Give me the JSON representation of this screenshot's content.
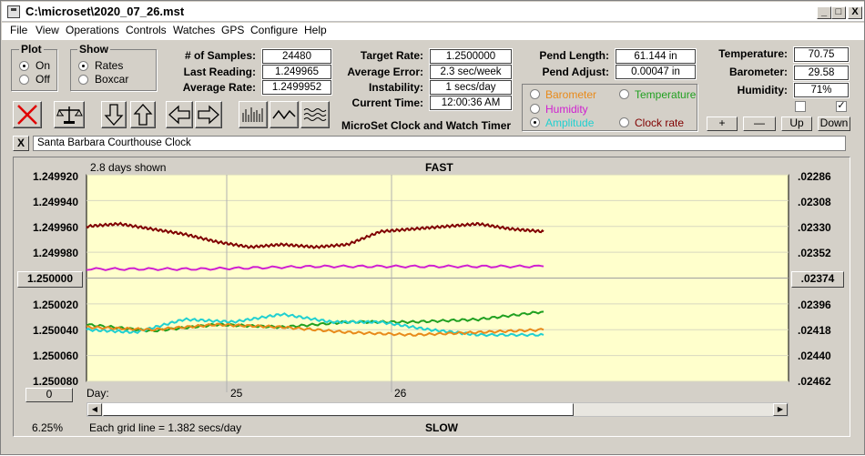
{
  "window": {
    "title": "C:\\microset\\2020_07_26.mst",
    "min": "_",
    "max": "□",
    "close": "X"
  },
  "menu": [
    "File",
    "View",
    "Operations",
    "Controls",
    "Watches",
    "GPS",
    "Configure",
    "Help"
  ],
  "plot_group": {
    "title": "Plot",
    "on": "On",
    "off": "Off"
  },
  "show_group": {
    "title": "Show",
    "rates": "Rates",
    "boxcar": "Boxcar"
  },
  "stats": {
    "samples_label": "# of Samples:",
    "samples": "24480",
    "last_label": "Last Reading:",
    "last": "1.249965",
    "avg_label": "Average Rate:",
    "avg": "1.2499952"
  },
  "target": {
    "rate_label": "Target Rate:",
    "rate": "1.2500000",
    "err_label": "Average Error:",
    "err": "2.3 sec/week",
    "inst_label": "Instability:",
    "inst": "1 secs/day",
    "time_label": "Current Time:",
    "time": "12:00:36 AM",
    "app_name": "MicroSet Clock and Watch Timer"
  },
  "pend": {
    "len_label": "Pend Length:",
    "len": "61.144 in",
    "adj_label": "Pend Adjust:",
    "adj": "0.00047 in"
  },
  "env": {
    "temp_label": "Temperature:",
    "temp": "70.75",
    "baro_label": "Barometer:",
    "baro": "29.58",
    "hum_label": "Humidity:",
    "hum": "71%"
  },
  "overlay": {
    "barometer": "Barometer",
    "temperature": "Temperature",
    "humidity": "Humidity",
    "amplitude": "Amplitude",
    "clock_rate": "Clock rate"
  },
  "colors": {
    "barometer": "#e88a1a",
    "temperature": "#20a020",
    "humidity": "#d020d0",
    "amplitude": "#20d0d0",
    "clock_rate": "#800000",
    "plot_bg": "#ffffcc"
  },
  "adjust_buttons": {
    "plus": "+",
    "minus": "—",
    "up": "Up",
    "down": "Down"
  },
  "clock_name": "Santa Barbara Courthouse Clock",
  "clear_btn": "X",
  "chart_data": {
    "type": "line",
    "top_label": "FAST",
    "bottom_label": "SLOW",
    "days_shown": "2.8 days shown",
    "left_ticks": [
      "1.249920",
      "1.249940",
      "1.249960",
      "1.249980",
      "1.250000",
      "1.250020",
      "1.250040",
      "1.250060",
      "1.250080"
    ],
    "right_ticks": [
      ".02286",
      ".02308",
      ".02330",
      ".02352",
      ".02374",
      ".02396",
      ".02418",
      ".02440",
      ".02462"
    ],
    "left_center_button": "1.250000",
    "right_center_button": ".02374",
    "x_label": "Day:",
    "x_ticks": [
      "25",
      "26"
    ],
    "zero_button": "0",
    "percent": "6.25%",
    "grid_note": "Each grid line = 1.382 secs/day",
    "ylim": [
      1.24992,
      1.25008
    ],
    "grid": true,
    "series": [
      {
        "name": "Clock rate",
        "color": "#800000",
        "x": [
          0,
          0.2,
          0.4,
          0.6,
          0.8,
          1.0,
          1.2,
          1.4,
          1.6,
          1.8,
          2.0,
          2.2,
          2.4,
          2.6,
          2.8
        ],
        "values": [
          1.24996,
          1.249958,
          1.249962,
          1.249966,
          1.249972,
          1.249976,
          1.249974,
          1.249976,
          1.249974,
          1.249964,
          1.249962,
          1.24996,
          1.249958,
          1.249962,
          1.249964
        ]
      },
      {
        "name": "Humidity",
        "color": "#d020d0",
        "x": [
          0,
          0.7,
          1.4,
          2.1,
          2.8
        ],
        "values": [
          1.249993,
          1.249993,
          1.249991,
          1.249991,
          1.249991
        ]
      },
      {
        "name": "Temperature",
        "color": "#20a020",
        "x": [
          0,
          0.4,
          0.8,
          1.2,
          1.6,
          2.0,
          2.4,
          2.8
        ],
        "values": [
          1.250036,
          1.250041,
          1.250036,
          1.250038,
          1.250034,
          1.250034,
          1.250032,
          1.250026
        ]
      },
      {
        "name": "Amplitude",
        "color": "#20d0d0",
        "x": [
          0,
          0.3,
          0.6,
          0.9,
          1.2,
          1.5,
          1.8,
          2.1,
          2.4,
          2.8
        ],
        "values": [
          1.25004,
          1.250042,
          1.250032,
          1.250034,
          1.250028,
          1.250034,
          1.250034,
          1.25004,
          1.250044,
          1.250044
        ]
      },
      {
        "name": "Barometer",
        "color": "#e88a1a",
        "x": [
          0,
          0.4,
          0.8,
          1.2,
          1.6,
          2.0,
          2.4,
          2.8
        ],
        "values": [
          1.250038,
          1.25004,
          1.250036,
          1.250038,
          1.250042,
          1.250044,
          1.250042,
          1.25004
        ]
      }
    ]
  }
}
